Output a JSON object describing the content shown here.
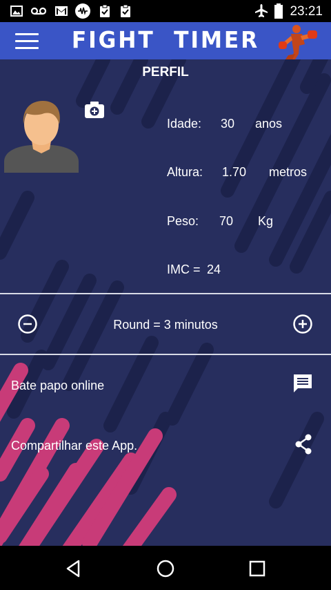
{
  "status_bar": {
    "time": "23:21",
    "left_icons": [
      "gallery-icon",
      "voicemail-icon",
      "gmail-icon",
      "sound-wave-icon",
      "clipboard-check-icon",
      "clipboard-check-icon"
    ],
    "right_icons": [
      "airplane-mode-icon",
      "battery-icon"
    ]
  },
  "app_bar": {
    "title": "FIGHT  TIMER",
    "color": "#3a55c6",
    "menu_icon": "hamburger-menu-icon",
    "logo_icon": "boxer-logo-icon"
  },
  "profile": {
    "section_title": "PERFIL",
    "stats": {
      "age": {
        "label": "Idade:",
        "value": "30",
        "unit": "anos"
      },
      "height": {
        "label": "Altura:",
        "value": "1.70",
        "unit": "metros"
      },
      "weight": {
        "label": "Peso:",
        "value": "70",
        "unit": "Kg"
      },
      "bmi": {
        "label": "IMC =",
        "value": "24"
      }
    }
  },
  "round": {
    "text": "Round = 3 minutos"
  },
  "menu": {
    "chat_label": "Bate papo online",
    "share_label": "Compartilhar este App."
  },
  "colors": {
    "background": "#272e5e",
    "stripe_dark": "#1b2148",
    "stripe_pink": "#c83b78"
  }
}
